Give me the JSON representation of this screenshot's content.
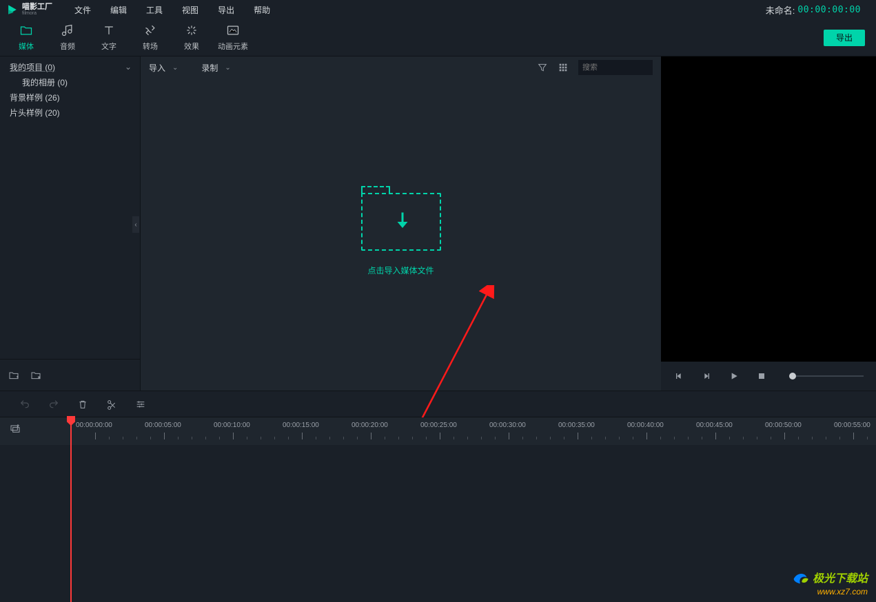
{
  "app": {
    "name_cn": "喵影工厂",
    "name_en": "filmora"
  },
  "menu": {
    "file": "文件",
    "edit": "编辑",
    "tools": "工具",
    "view": "视图",
    "export": "导出",
    "help": "帮助"
  },
  "project": {
    "label": "未命名:",
    "time": "00:00:00:00"
  },
  "tabs": {
    "media": "媒体",
    "audio": "音频",
    "text": "文字",
    "transition": "转场",
    "effects": "效果",
    "elements": "动画元素"
  },
  "export_btn": "导出",
  "sidebar": {
    "items": [
      {
        "label": "我的项目 (0)"
      },
      {
        "label": "我的相册 (0)"
      },
      {
        "label": "背景样例 (26)"
      },
      {
        "label": "片头样例 (20)"
      }
    ]
  },
  "media_bar": {
    "import": "导入",
    "record": "录制",
    "search_placeholder": "搜索"
  },
  "drop": {
    "text": "点击导入媒体文件"
  },
  "timeline": {
    "stamps": [
      "00:00:00:00",
      "00:00:05:00",
      "00:00:10:00",
      "00:00:15:00",
      "00:00:20:00",
      "00:00:25:00",
      "00:00:30:00",
      "00:00:35:00",
      "00:00:40:00",
      "00:00:45:00",
      "00:00:50:00",
      "00:00:55:00"
    ]
  },
  "watermark": {
    "text": "极光下载站",
    "url": "www.xz7.com"
  }
}
